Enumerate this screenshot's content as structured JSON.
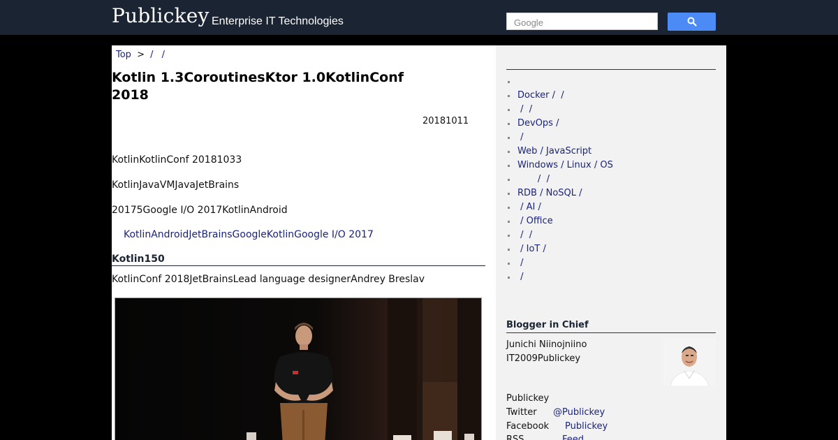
{
  "header": {
    "logo": "Publickey",
    "tagline": "Enterprise IT Technologies",
    "search_placeholder": "Google",
    "search_icon": "magnifier-icon",
    "bg_color": "#1b2433",
    "search_button_color": "#4c8bf5"
  },
  "breadcrumb": {
    "top": "Top",
    "arrow": ">",
    "sep1": "/",
    "sep2": "/"
  },
  "article": {
    "title": "Kotlin 1.3CoroutinesKtor 1.0KotlinConf 2018",
    "date": "20181011",
    "para1": "KotlinKotlinConf 20181033",
    "para2": "KotlinJavaVMJavaJetBrains",
    "para3": "20175Google I/O 2017KotlinAndroid",
    "quote_link": "KotlinAndroidJetBrainsGoogleKotlinGoogle I/O 2017",
    "section_heading": "Kotlin150",
    "para4": "KotlinConf 2018JetBrainsLead language designerAndrey Breslav"
  },
  "sidebar": {
    "categories": [
      "",
      "Docker /  /",
      " /  /",
      "DevOps /",
      " /",
      "Web / JavaScript",
      "Windows / Linux / OS",
      "       /  /",
      "RDB / NoSQL /",
      " / AI /",
      " / Office",
      " /  /",
      " / IoT /",
      " /",
      " /"
    ],
    "blogger_heading": "Blogger in Chief",
    "profile_name": "Junichi Niinojniino",
    "profile_bio": "IT2009Publickey",
    "contact_title": "Publickey",
    "twitter_label": "Twitter",
    "twitter_value": "@Publickey",
    "facebook_label": "Facebook",
    "facebook_value": "Publickey",
    "rss_label": "RSS",
    "rss_value": "Feed"
  }
}
